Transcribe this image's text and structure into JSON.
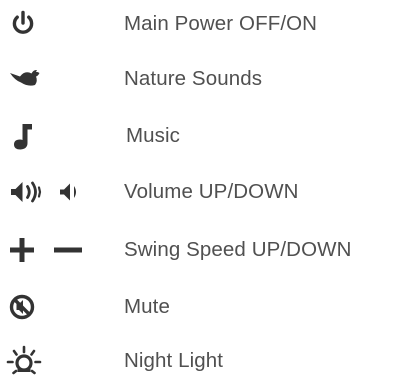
{
  "colors": {
    "icon": "#333333",
    "text": "#505050",
    "background": "#ffffff"
  },
  "legend": [
    {
      "icon": "power-icon",
      "label": "Main Power OFF/ON"
    },
    {
      "icon": "bird-icon",
      "label": "Nature Sounds"
    },
    {
      "icon": "music-note-icon",
      "label": "Music"
    },
    {
      "icon": "volume-up-icon volume-down-icon",
      "label": "Volume UP/DOWN"
    },
    {
      "icon": "plus-icon minus-icon",
      "label": "Swing Speed UP/DOWN"
    },
    {
      "icon": "mute-icon",
      "label": "Mute"
    },
    {
      "icon": "night-light-icon",
      "label": "Night Light"
    }
  ]
}
